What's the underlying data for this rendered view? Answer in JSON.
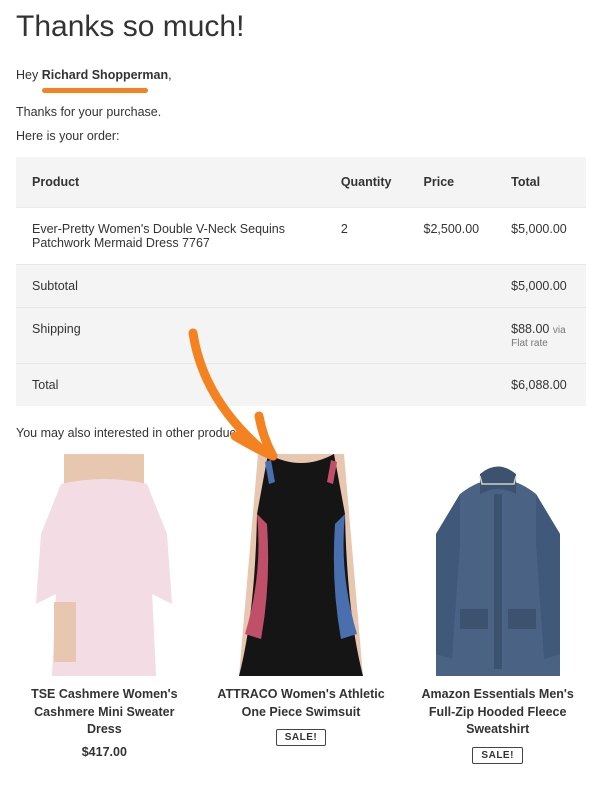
{
  "title": "Thanks so much!",
  "greeting_prefix": "Hey ",
  "customer_name": "Richard Shopperman",
  "greeting_suffix": ",",
  "line1": "Thanks for your purchase.",
  "line2": "Here is your order:",
  "table": {
    "headers": {
      "product": "Product",
      "quantity": "Quantity",
      "price": "Price",
      "total": "Total"
    },
    "item": {
      "name": "Ever-Pretty Women's Double V-Neck Sequins Patchwork Mermaid Dress 7767",
      "qty": "2",
      "price": "$2,500.00",
      "total": "$5,000.00"
    },
    "subtotal_label": "Subtotal",
    "subtotal_value": "$5,000.00",
    "shipping_label": "Shipping",
    "shipping_value": "$88.00",
    "shipping_via": "via",
    "shipping_method": "Flat rate",
    "total_label": "Total",
    "total_value": "$6,088.00"
  },
  "also_label": "You may also interested in other products:",
  "products": [
    {
      "name": "TSE Cashmere Women's Cashmere Mini Sweater Dress",
      "price": "$417.00",
      "sale": false
    },
    {
      "name": "ATTRACO Women's Athletic One Piece Swimsuit",
      "price": "",
      "sale": true,
      "sale_label": "SALE!"
    },
    {
      "name": "Amazon Essentials Men's Full-Zip Hooded Fleece Sweatshirt",
      "price": "",
      "sale": true,
      "sale_label": "SALE!"
    }
  ],
  "annotation_color": "#f58220"
}
